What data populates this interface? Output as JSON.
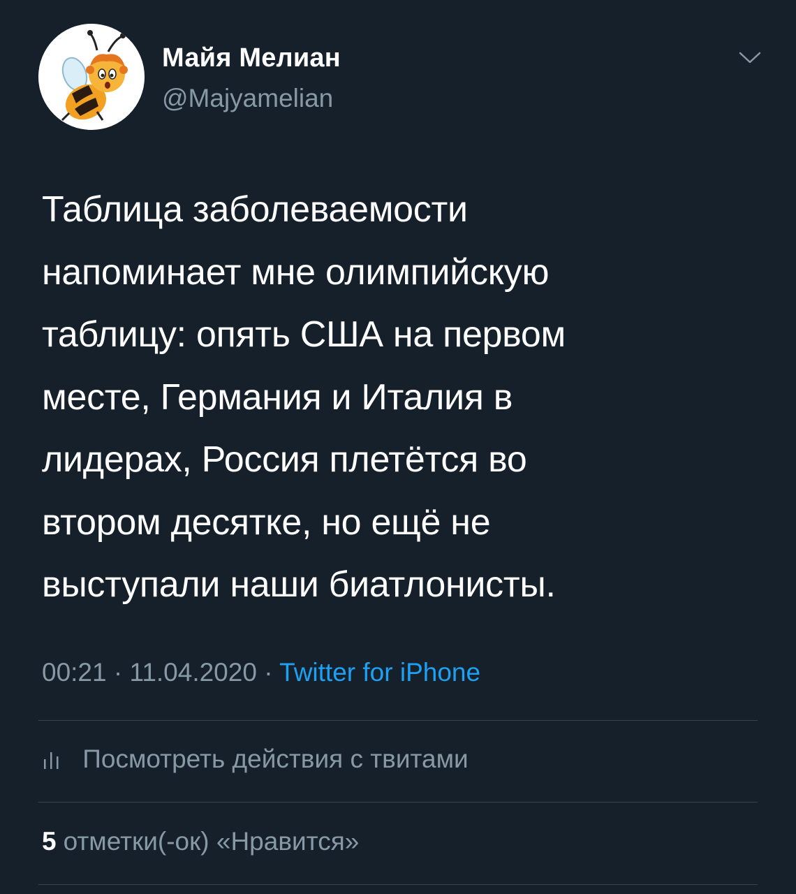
{
  "author": {
    "display_name": "Майя Мелиан",
    "handle": "@Majyamelian",
    "avatar_icon": "bee-avatar-icon"
  },
  "tweet": {
    "lines": [
      "Таблица заболеваемости",
      "напоминает мне олимпийскую",
      "таблицу: опять США на первом",
      "месте, Германия и Италия в",
      "лидерах, Россия плетётся во",
      "втором десятке, но ещё не",
      "выступали наши биатлонисты."
    ],
    "time": "00:21",
    "separator": "·",
    "date": "11.04.2020",
    "source": "Twitter for iPhone"
  },
  "activity": {
    "label": "Посмотреть действия с твитами",
    "icon": "analytics-icon"
  },
  "likes": {
    "count": "5",
    "label": "отметки(-ок) «Нравится»"
  },
  "colors": {
    "background": "#15202b",
    "primary_text": "#ffffff",
    "secondary_text": "#8899a6",
    "link": "#1da1f2",
    "divider": "#38444d"
  }
}
